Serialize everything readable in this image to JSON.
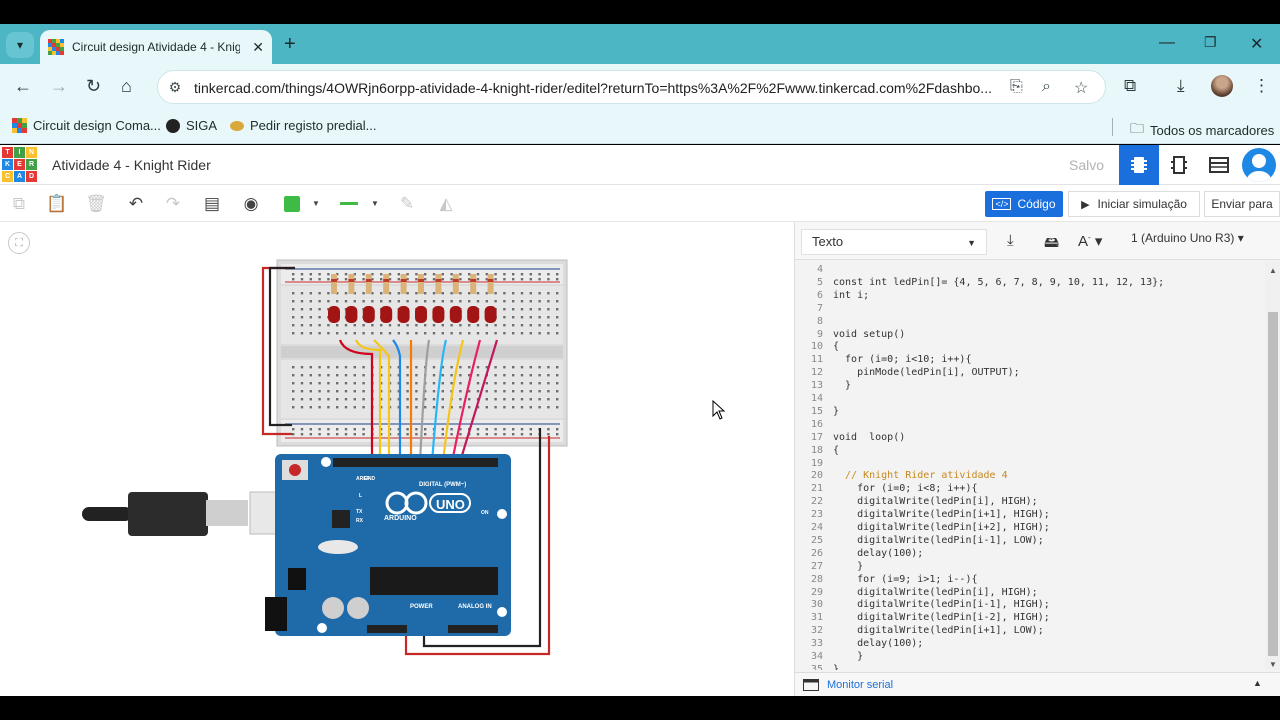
{
  "browser": {
    "tab_title": "Circuit design Atividade 4 - Knig",
    "url": "tinkercad.com/things/4OWRjn6orpp-atividade-4-knight-rider/editel?returnTo=https%3A%2F%2Fwww.tinkercad.com%2Fdashbo...",
    "bookmarks": [
      {
        "label": "Circuit design Coma..."
      },
      {
        "label": "SIGA"
      },
      {
        "label": "Pedir registo predial..."
      }
    ],
    "all_bookmarks_label": "Todos os marcadores"
  },
  "app": {
    "logo_letters": [
      "T",
      "I",
      "N",
      "K",
      "E",
      "R",
      "C",
      "A",
      "D"
    ],
    "project_title": "Atividade 4 - Knight Rider",
    "saved_status": "Salvo"
  },
  "toolbar": {
    "code_label": "Código",
    "simulate_label": "Iniciar simulação",
    "send_label": "Enviar para"
  },
  "code_panel": {
    "mode": "Texto",
    "device": "1 (Arduino Uno R3)",
    "serial_monitor_label": "Monitor serial",
    "lines": [
      {
        "n": "4",
        "t": ""
      },
      {
        "n": "5",
        "t": "const int ledPin[]= {4, 5, 6, 7, 8, 9, 10, 11, 12, 13};"
      },
      {
        "n": "6",
        "t": "int i;"
      },
      {
        "n": "7",
        "t": ""
      },
      {
        "n": "8",
        "t": ""
      },
      {
        "n": "9",
        "t": "void setup()"
      },
      {
        "n": "10",
        "t": "{"
      },
      {
        "n": "11",
        "t": "  for (i=0; i<10; i++){"
      },
      {
        "n": "12",
        "t": "    pinMode(ledPin[i], OUTPUT);"
      },
      {
        "n": "13",
        "t": "  }"
      },
      {
        "n": "14",
        "t": ""
      },
      {
        "n": "15",
        "t": "}"
      },
      {
        "n": "16",
        "t": ""
      },
      {
        "n": "17",
        "t": "void  loop()"
      },
      {
        "n": "18",
        "t": "{"
      },
      {
        "n": "19",
        "t": ""
      },
      {
        "n": "20",
        "t": "  // Knight Rider atividade 4",
        "comment": true
      },
      {
        "n": "21",
        "t": "    for (i=0; i<8; i++){"
      },
      {
        "n": "22",
        "t": "    digitalWrite(ledPin[i], HIGH);"
      },
      {
        "n": "23",
        "t": "    digitalWrite(ledPin[i+1], HIGH);"
      },
      {
        "n": "24",
        "t": "    digitalWrite(ledPin[i+2], HIGH);"
      },
      {
        "n": "25",
        "t": "    digitalWrite(ledPin[i-1], LOW);"
      },
      {
        "n": "26",
        "t": "    delay(100);"
      },
      {
        "n": "27",
        "t": "    }"
      },
      {
        "n": "28",
        "t": "    for (i=9; i>1; i--){"
      },
      {
        "n": "29",
        "t": "    digitalWrite(ledPin[i], HIGH);"
      },
      {
        "n": "30",
        "t": "    digitalWrite(ledPin[i-1], HIGH);"
      },
      {
        "n": "31",
        "t": "    digitalWrite(ledPin[i-2], HIGH);"
      },
      {
        "n": "32",
        "t": "    digitalWrite(ledPin[i+1], LOW);"
      },
      {
        "n": "33",
        "t": "    delay(100);"
      },
      {
        "n": "34",
        "t": "    }"
      },
      {
        "n": "35",
        "t": "}"
      }
    ]
  },
  "board": {
    "arduino_label": "ARDUINO",
    "uno_label": "UNO",
    "digital_label": "DIGITAL (PWM~)",
    "power_label": "POWER",
    "analog_label": "ANALOG IN",
    "on_label": "ON",
    "l_label": "L",
    "tx_label": "TX",
    "rx_label": "RX",
    "aref_label": "AREF",
    "gnd_label": "GND",
    "led_count": 10,
    "wire_colors": [
      "#d0021b",
      "#f5c518",
      "#f5a623",
      "#1e88e5",
      "#f57c00",
      "#9e9e9e",
      "#29b6f6",
      "#f5c518",
      "#e91e63",
      "#e91e63",
      "#c2185b"
    ]
  }
}
